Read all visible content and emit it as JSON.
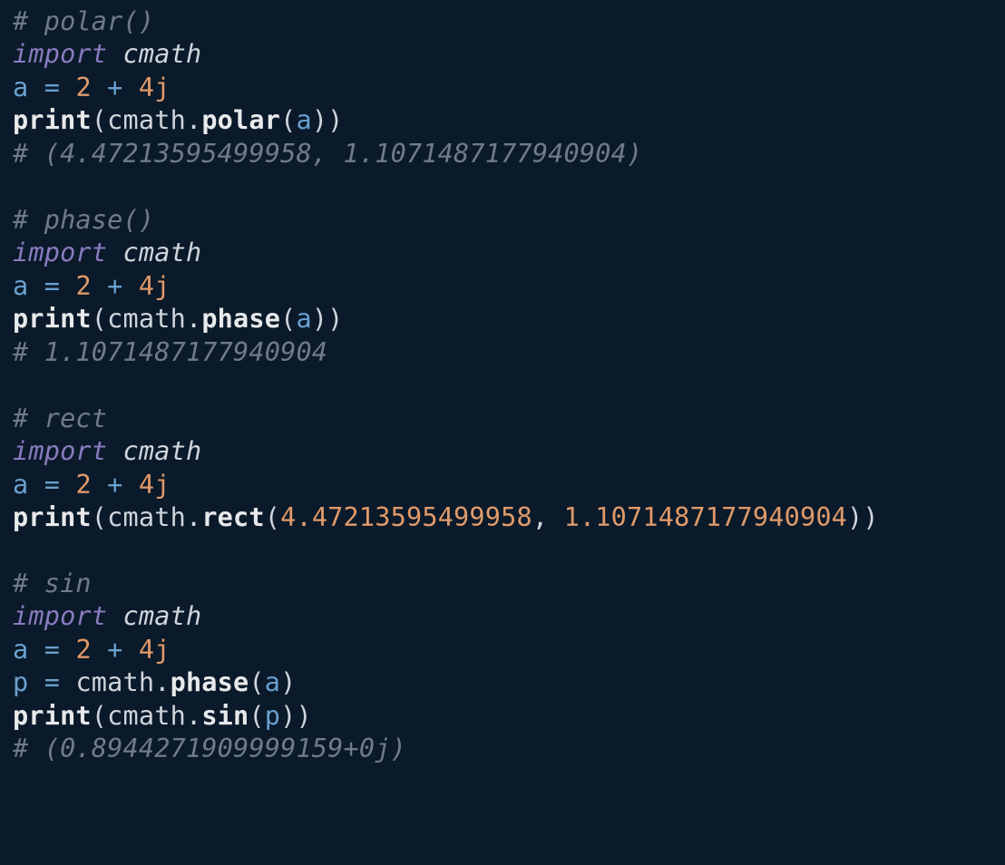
{
  "b1": {
    "c1": "# polar()",
    "imp": "import",
    "mod": "cmath",
    "assign_var": "a",
    "eq": "=",
    "n1": "2",
    "plus": "+",
    "n2": "4j",
    "print": "print",
    "fn": "polar",
    "arg": "a",
    "c2": "# (4.47213595499958, 1.1071487177940904)"
  },
  "b2": {
    "c1": "# phase()",
    "imp": "import",
    "mod": "cmath",
    "assign_var": "a",
    "eq": "=",
    "n1": "2",
    "plus": "+",
    "n2": "4j",
    "print": "print",
    "fn": "phase",
    "arg": "a",
    "c2": "# 1.1071487177940904"
  },
  "b3": {
    "c1": "# rect",
    "imp": "import",
    "mod": "cmath",
    "assign_var": "a",
    "eq": "=",
    "n1": "2",
    "plus": "+",
    "n2": "4j",
    "print": "print",
    "fn": "rect",
    "arg1": "4.47213595499958",
    "comma": ", ",
    "arg2": "1.1071487177940904"
  },
  "b4": {
    "c1": "# sin",
    "imp": "import",
    "mod": "cmath",
    "assign_var": "a",
    "eq": "=",
    "n1": "2",
    "plus": "+",
    "n2": "4j",
    "pvar": "p",
    "peq": "=",
    "pmod": "cmath",
    "pfn": "phase",
    "parg": "a",
    "print": "print",
    "fn": "sin",
    "arg": "p",
    "c2": "# (0.8944271909999159+0j)"
  }
}
